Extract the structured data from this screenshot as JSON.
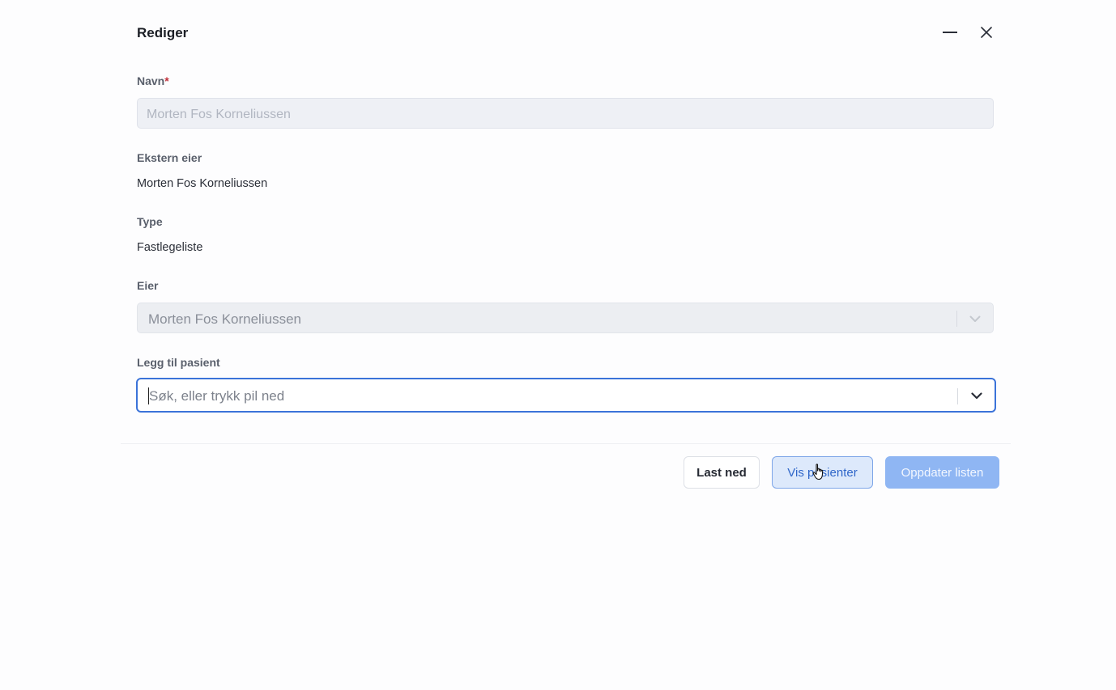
{
  "dialog": {
    "title": "Rediger",
    "minimize_icon": "minimize-icon",
    "close_icon": "close-icon"
  },
  "fields": {
    "name": {
      "label": "Navn",
      "required_mark": "*",
      "value": "Morten Fos Korneliussen"
    },
    "external_owner": {
      "label": "Ekstern eier",
      "value": "Morten Fos Korneliussen"
    },
    "type": {
      "label": "Type",
      "value": "Fastlegeliste"
    },
    "owner": {
      "label": "Eier",
      "selected": "Morten Fos Korneliussen",
      "icon": "chevron-down-icon"
    },
    "add_patient": {
      "label": "Legg til pasient",
      "placeholder": "Søk, eller trykk pil ned",
      "icon": "chevron-down-icon"
    }
  },
  "footer": {
    "download_label": "Last ned",
    "show_patients_label": "Vis pasienter",
    "update_list_label": "Oppdater listen"
  },
  "colors": {
    "accent": "#3b73d9",
    "primary_disabled": "#8fb6f3",
    "required": "#c0313b"
  }
}
